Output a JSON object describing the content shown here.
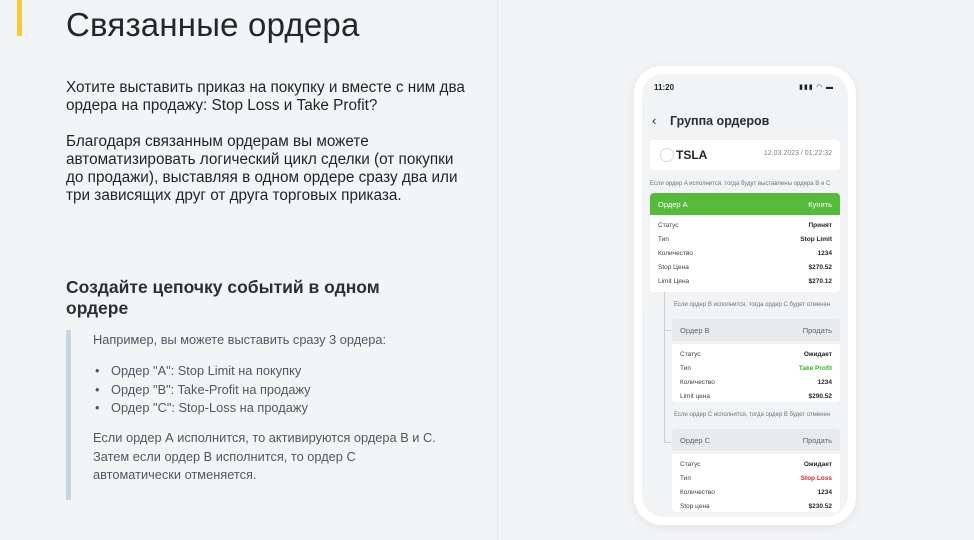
{
  "title": "Связанные ордера",
  "intro": {
    "p1": "Хотите выставить приказ на покупку и вместе с ним два ордера на продажу: Stop Loss и Take Profit?",
    "p2": "Благодаря связанным ордерам вы можете автоматизировать логический цикл сделки (от покупки до продажи), выставляя в одном ордере сразу два или три зависящих друг от друга торговых приказа."
  },
  "section_title": "Создайте цепочку событий в одном ордере",
  "example": {
    "lead": "Например, вы можете выставить сразу 3 ордера:",
    "items": [
      "Ордер \"A\": Stop Limit на покупку",
      "Ордер \"B\": Take-Profit на продажу",
      "Ордер \"C\": Stop-Loss на продажу"
    ],
    "note": "Если ордер А исполнится, то активируются ордера В и С. Затем если ордер В исполнится, то ордер С автоматически отменяется."
  },
  "phone": {
    "time": "11:20",
    "status_icons": "▮▮▮ ◠ ▬",
    "nav_back": "‹",
    "nav_title": "Группа ордеров",
    "ticker": "TSLA",
    "datetime": "12.03.2023 / 01:22:32",
    "hint_a": "Если ордер A исполнится, тогда будут выставлены ордера B и C",
    "hint_b": "Если ордер B исполнится, тогда ордер C будет отменен",
    "hint_c": "Если ордер C исполнится, тогда ордер B будет отменен",
    "order_a": {
      "name": "Ордер A",
      "action": "Купить",
      "rows": [
        {
          "k": "Статус",
          "v": "Принят"
        },
        {
          "k": "Тип",
          "v": "Stop Limit"
        },
        {
          "k": "Количество",
          "v": "1234"
        },
        {
          "k": "Stop Цена",
          "v": "$270.52"
        },
        {
          "k": "Limit Цена",
          "v": "$270.12"
        }
      ]
    },
    "order_b": {
      "name": "Ордер B",
      "action": "Продать",
      "rows": [
        {
          "k": "Статус",
          "v": "Ожидает"
        },
        {
          "k": "Тип",
          "v": "Take Profit"
        },
        {
          "k": "Количество",
          "v": "1234"
        },
        {
          "k": "Limit цена",
          "v": "$290.52"
        }
      ]
    },
    "order_c": {
      "name": "Ордер C",
      "action": "Продать",
      "rows": [
        {
          "k": "Статус",
          "v": "Ожидает"
        },
        {
          "k": "Тип",
          "v": "Stop Loss"
        },
        {
          "k": "Количество",
          "v": "1234"
        },
        {
          "k": "Stop цена",
          "v": "$230.52"
        }
      ]
    },
    "colors": {
      "green": "#56bb3c",
      "profit": "#3fae2a",
      "loss": "#e2262b"
    }
  }
}
